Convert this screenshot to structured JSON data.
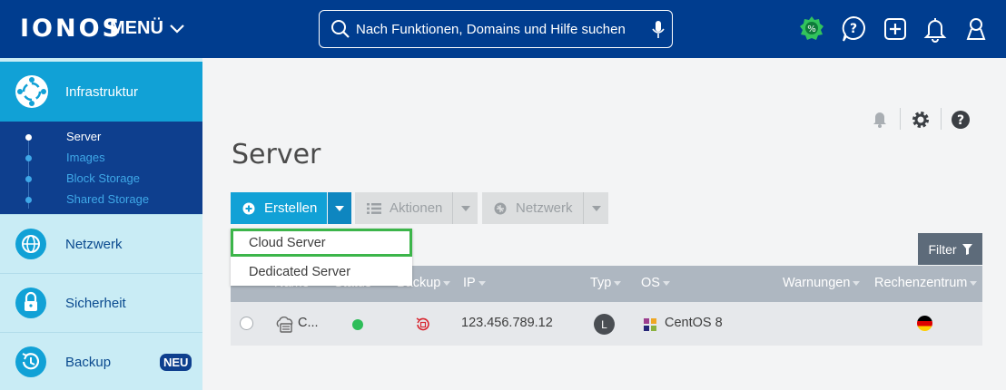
{
  "topbar": {
    "logo": "IONOS",
    "menu_label": "MENÜ",
    "search_placeholder": "Nach Funktionen, Domains und Hilfe suchen",
    "icons": [
      "promo-badge-icon",
      "help-icon",
      "add-icon",
      "bell-icon",
      "user-icon"
    ]
  },
  "sidebar": {
    "active": {
      "label": "Infrastruktur",
      "icon": "infrastructure-icon"
    },
    "sub_items": [
      {
        "label": "Server",
        "active": true
      },
      {
        "label": "Images",
        "active": false
      },
      {
        "label": "Block Storage",
        "active": false
      },
      {
        "label": "Shared Storage",
        "active": false
      }
    ],
    "items": [
      {
        "label": "Netzwerk",
        "icon": "network-icon"
      },
      {
        "label": "Sicherheit",
        "icon": "lock-icon"
      },
      {
        "label": "Backup",
        "icon": "backup-icon",
        "badge": "NEU"
      }
    ]
  },
  "main": {
    "title": "Server",
    "toolbar": {
      "create_label": "Erstellen",
      "actions_label": "Aktionen",
      "network_label": "Netzwerk"
    },
    "dropdown": [
      {
        "label": "Cloud Server",
        "highlighted": true
      },
      {
        "label": "Dedicated Server",
        "highlighted": false
      }
    ],
    "filter_label": "Filter",
    "table": {
      "columns": [
        "Name",
        "Status",
        "Backup",
        "IP",
        "Typ",
        "OS",
        "Warnungen",
        "Rechenzentrum"
      ],
      "rows": [
        {
          "name": "C...",
          "status": "online",
          "ip": "123.456.789.12",
          "typ": "L",
          "os": "CentOS 8",
          "datacenter_flag": "de-flag-icon"
        }
      ]
    }
  },
  "colors": {
    "topbar": "#003d8f",
    "accent": "#11a1d6",
    "highlight_border": "#3cb54a",
    "status_online": "#2ebd59"
  }
}
